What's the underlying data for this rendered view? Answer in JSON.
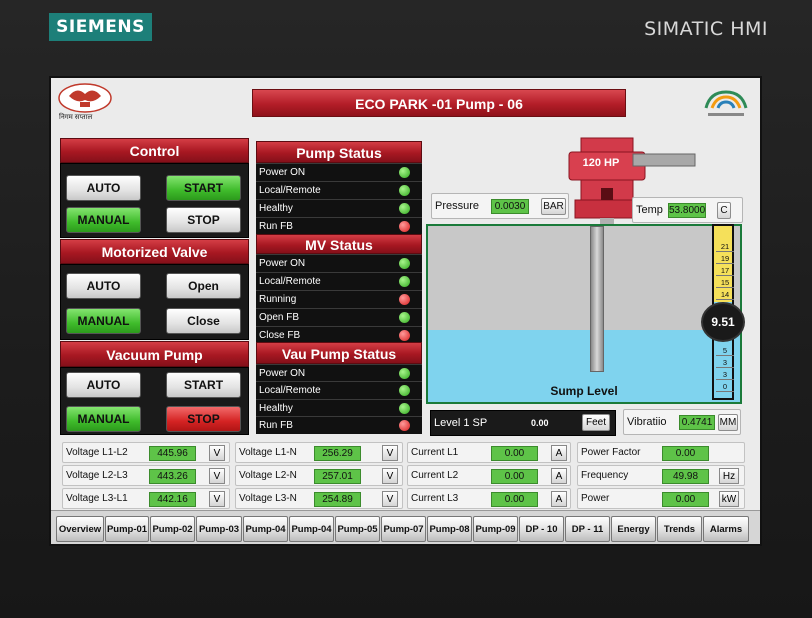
{
  "device": {
    "brand": "SIEMENS",
    "model": "SIMATIC HMI"
  },
  "header": {
    "title": "ECO PARK -01 Pump - 06",
    "logo_left_caption": "निगम सप्ताल"
  },
  "control": {
    "title": "Control",
    "auto": "AUTO",
    "start": "START",
    "manual": "MANUAL",
    "stop": "STOP"
  },
  "motorized_valve": {
    "title": "Motorized Valve",
    "auto": "AUTO",
    "open": "Open",
    "manual": "MANUAL",
    "close": "Close"
  },
  "vacuum_pump": {
    "title": "Vacuum Pump",
    "auto": "AUTO",
    "start": "START",
    "manual": "MANUAL",
    "stop": "STOP"
  },
  "pump_status": {
    "title": "Pump Status",
    "rows": [
      {
        "label": "Power  ON",
        "status": "green"
      },
      {
        "label": "Local/Remote",
        "status": "green"
      },
      {
        "label": "Healthy",
        "status": "green"
      },
      {
        "label": "Run FB",
        "status": "red"
      }
    ]
  },
  "mv_status": {
    "title": "MV Status",
    "rows": [
      {
        "label": "Power  ON",
        "status": "green"
      },
      {
        "label": "Local/Remote",
        "status": "green"
      },
      {
        "label": "Running",
        "status": "red"
      },
      {
        "label": "Open FB",
        "status": "green"
      },
      {
        "label": "Close FB",
        "status": "red"
      }
    ]
  },
  "vau_status": {
    "title": "Vau Pump Status",
    "rows": [
      {
        "label": "Power  ON",
        "status": "green"
      },
      {
        "label": "Local/Remote",
        "status": "green"
      },
      {
        "label": "Healthy",
        "status": "green"
      },
      {
        "label": "Run FB",
        "status": "red"
      }
    ]
  },
  "pump": {
    "rating": "120 HP"
  },
  "pressure": {
    "label": "Pressure",
    "value": "0.0030",
    "unit": "BAR"
  },
  "temp": {
    "label": "Temp",
    "value": "53.8000",
    "unit": "C"
  },
  "sump": {
    "label": "Sump Level",
    "level_value": "9.51",
    "scale": [
      "21",
      "19",
      "17",
      "15",
      "14",
      "5",
      "3",
      "3",
      "0"
    ]
  },
  "level_sp": {
    "label": "Level 1 SP",
    "value": "0.00",
    "unit": "Feet"
  },
  "vibration": {
    "label": "Vibratiio",
    "value": "0.4741",
    "unit": "MM"
  },
  "measurements": {
    "col1": [
      {
        "label": "Voltage L1-L2",
        "value": "445.96",
        "unit": "V"
      },
      {
        "label": "Voltage L2-L3",
        "value": "443.26",
        "unit": "V"
      },
      {
        "label": "Voltage L3-L1",
        "value": "442.16",
        "unit": "V"
      }
    ],
    "col2": [
      {
        "label": "Voltage L1-N",
        "value": "256.29",
        "unit": "V"
      },
      {
        "label": "Voltage L2-N",
        "value": "257.01",
        "unit": "V"
      },
      {
        "label": "Voltage L3-N",
        "value": "254.89",
        "unit": "V"
      }
    ],
    "col3": [
      {
        "label": "Current L1",
        "value": "0.00",
        "unit": "A"
      },
      {
        "label": "Current L2",
        "value": "0.00",
        "unit": "A"
      },
      {
        "label": "Current L3",
        "value": "0.00",
        "unit": "A"
      }
    ],
    "col4": [
      {
        "label": "Power Factor",
        "value": "0.00",
        "unit": ""
      },
      {
        "label": "Frequency",
        "value": "49.98",
        "unit": "Hz"
      },
      {
        "label": "Power",
        "value": "0.00",
        "unit": "kW"
      }
    ]
  },
  "nav": [
    "Overview",
    "Pump-01",
    "Pump-02",
    "Pump-03",
    "Pump-04",
    "Pump-04",
    "Pump-05",
    "Pump-07",
    "Pump-08",
    "Pump-09",
    "DP - 10",
    "DP - 11",
    "Energy",
    "Trends",
    "Alarms"
  ],
  "colors": {
    "accent_red": "#b31d28",
    "status_green": "#3fbb2b",
    "status_red": "#d81d1d",
    "water": "#7fd3ee"
  }
}
